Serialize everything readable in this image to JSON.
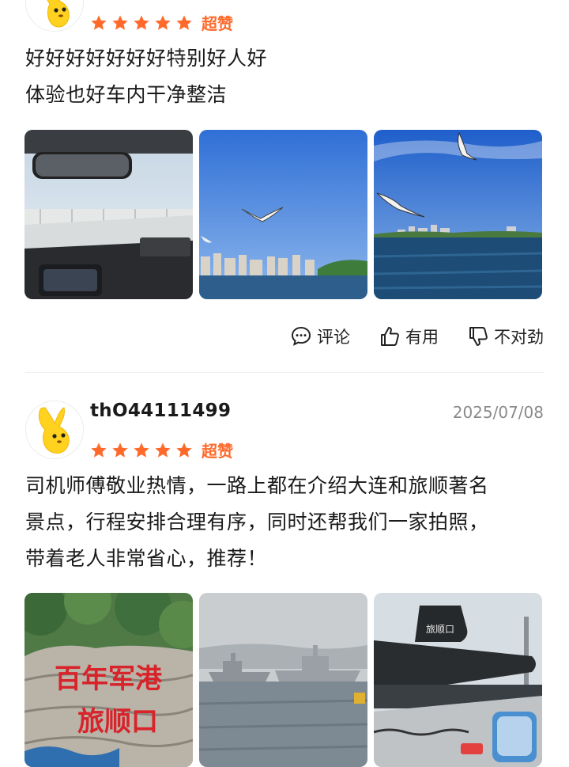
{
  "accent_color": "#ff6a2b",
  "reviews": [
    {
      "username": "",
      "date": "",
      "stars": 5,
      "rating_label": "超赞",
      "text_lines": [
        "好好好好好好好特别好人好",
        "体验也好车内干净整洁"
      ],
      "photos": [
        {
          "icon": "car-interior-bridge-photo"
        },
        {
          "icon": "seagull-sky-city-photo"
        },
        {
          "icon": "seagull-sea-photo"
        }
      ],
      "actions": {
        "comment": "评论",
        "helpful": "有用",
        "not_right": "不对劲"
      }
    },
    {
      "username": "thO44111499",
      "date": "2025/07/08",
      "stars": 5,
      "rating_label": "超赞",
      "text_lines": [
        "司机师傅敬业热情，一路上都在介绍大连和旅顺著名",
        "景点，行程安排合理有序，同时还帮我们一家拍照，",
        "带着老人非常省心，推荐！"
      ],
      "photos": [
        {
          "icon": "lushunkou-harbor-stone-photo",
          "sign_line1": "百年军港",
          "sign_line2": "旅顺口"
        },
        {
          "icon": "warships-harbor-photo"
        },
        {
          "icon": "submarine-museum-photo",
          "sign": "旅顺口"
        }
      ]
    }
  ]
}
